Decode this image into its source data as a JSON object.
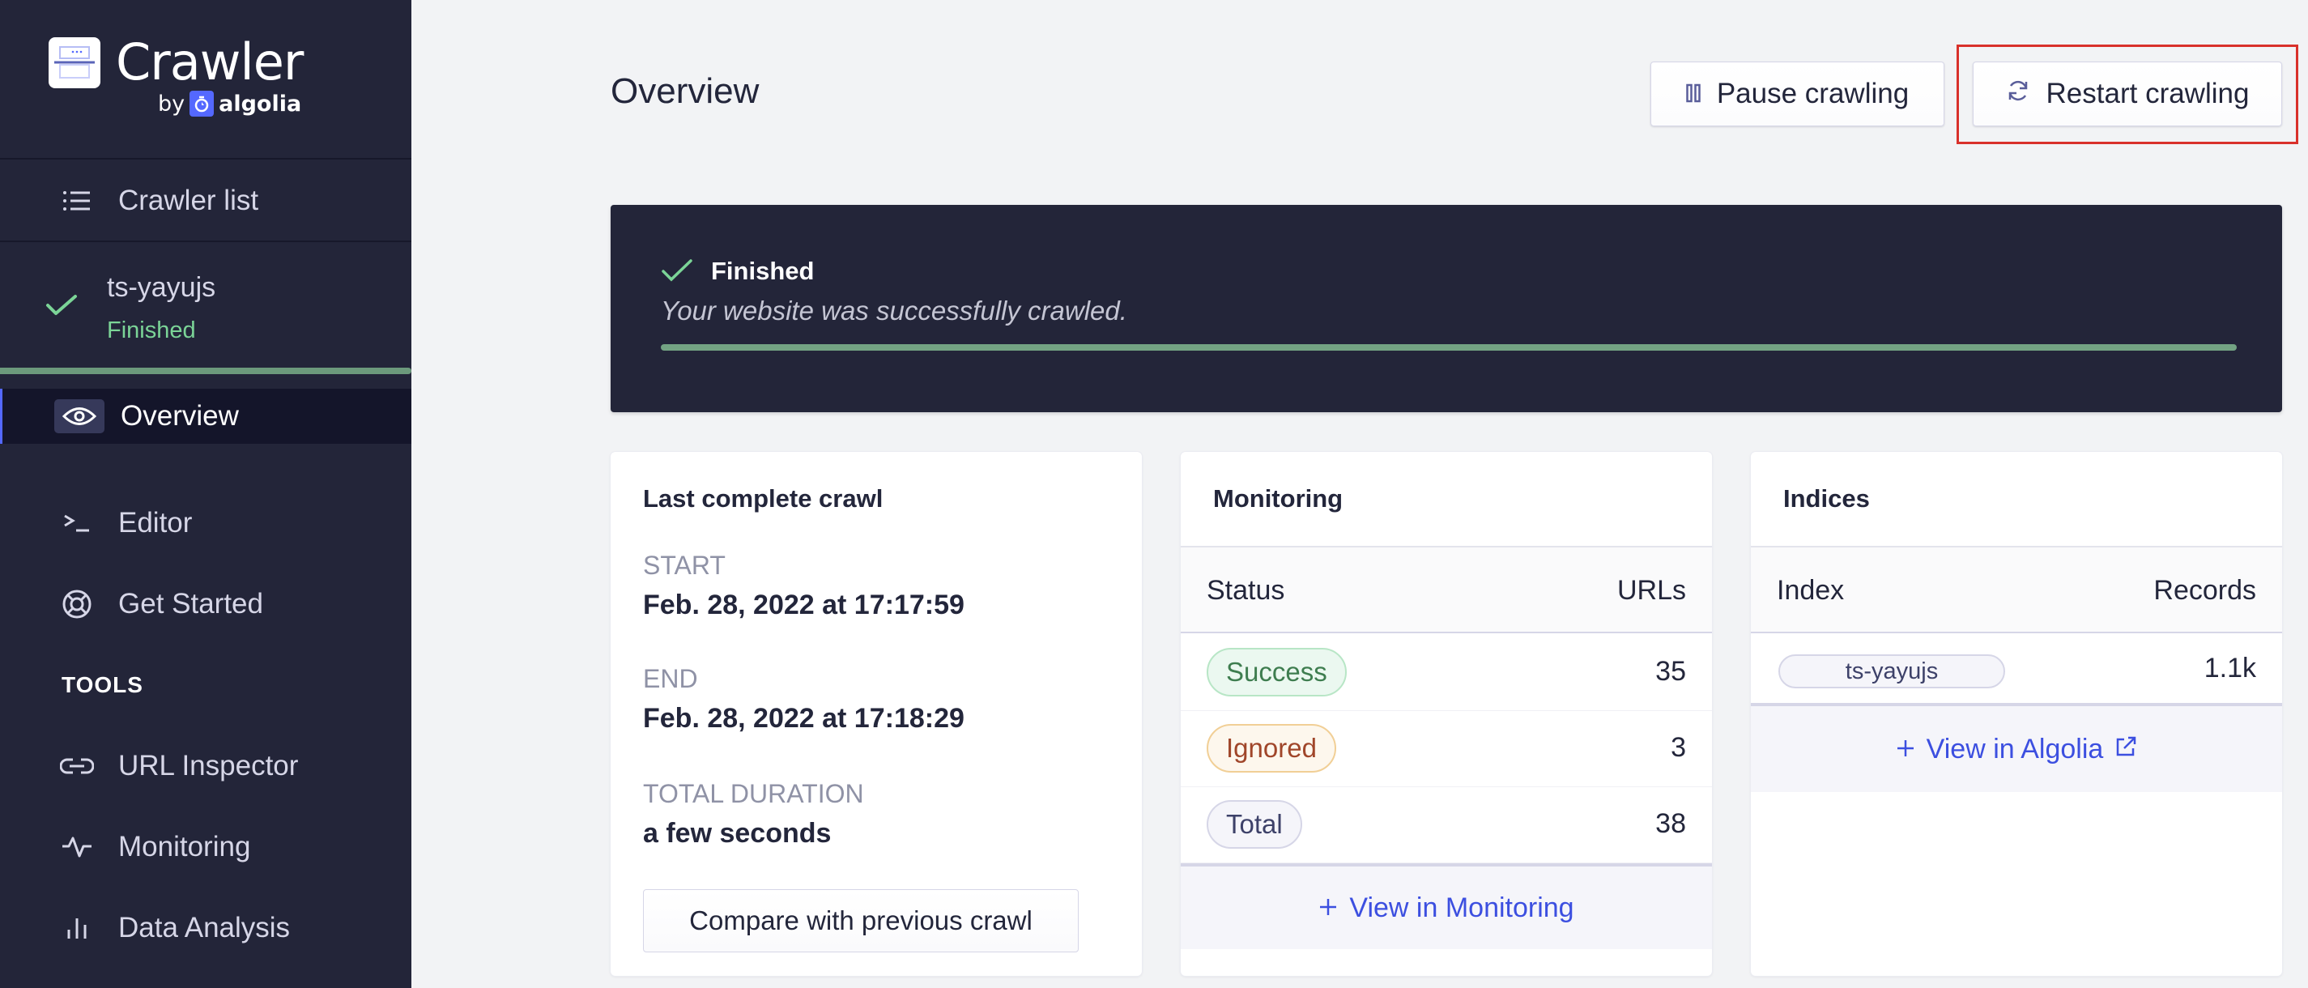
{
  "app": {
    "name": "Crawler",
    "by": "by",
    "brand": "algolia"
  },
  "sidebar": {
    "crawler_list_label": "Crawler list",
    "crawler": {
      "name": "ts-yayujs",
      "status": "Finished",
      "progress": 1.0
    },
    "items": [
      {
        "label": "Overview",
        "icon": "eye-icon",
        "active": true
      },
      {
        "label": "Editor",
        "icon": "terminal-icon",
        "active": false
      },
      {
        "label": "Get Started",
        "icon": "lifebuoy-icon",
        "active": false
      }
    ],
    "tools_heading": "TOOLS",
    "tools": [
      {
        "label": "URL Inspector",
        "icon": "link-icon"
      },
      {
        "label": "Monitoring",
        "icon": "activity-icon"
      },
      {
        "label": "Data Analysis",
        "icon": "bar-chart-icon"
      }
    ]
  },
  "header": {
    "title": "Overview",
    "pause_label": "Pause crawling",
    "restart_label": "Restart crawling"
  },
  "banner": {
    "status": "Finished",
    "message": "Your website was successfully crawled.",
    "progress": 1.0
  },
  "last_crawl": {
    "title": "Last complete crawl",
    "start_label": "START",
    "start_value": "Feb. 28, 2022 at 17:17:59",
    "end_label": "END",
    "end_value": "Feb. 28, 2022 at 17:18:29",
    "duration_label": "TOTAL DURATION",
    "duration_value": "a few seconds",
    "compare_label": "Compare with previous crawl"
  },
  "monitoring": {
    "title": "Monitoring",
    "columns": [
      "Status",
      "URLs"
    ],
    "rows": [
      {
        "status": "Success",
        "urls": "35"
      },
      {
        "status": "Ignored",
        "urls": "3"
      },
      {
        "status": "Total",
        "urls": "38"
      }
    ],
    "footer_label": "View in Monitoring"
  },
  "indices": {
    "title": "Indices",
    "columns": [
      "Index",
      "Records"
    ],
    "rows": [
      {
        "index": "ts-yayujs",
        "records": "1.1k"
      }
    ],
    "footer_label": "View in Algolia"
  },
  "colors": {
    "sidebar_bg": "#232539",
    "accent": "#5468ff",
    "success": "#7bd497",
    "link": "#3c4fe0",
    "highlight": "#d9312b"
  }
}
